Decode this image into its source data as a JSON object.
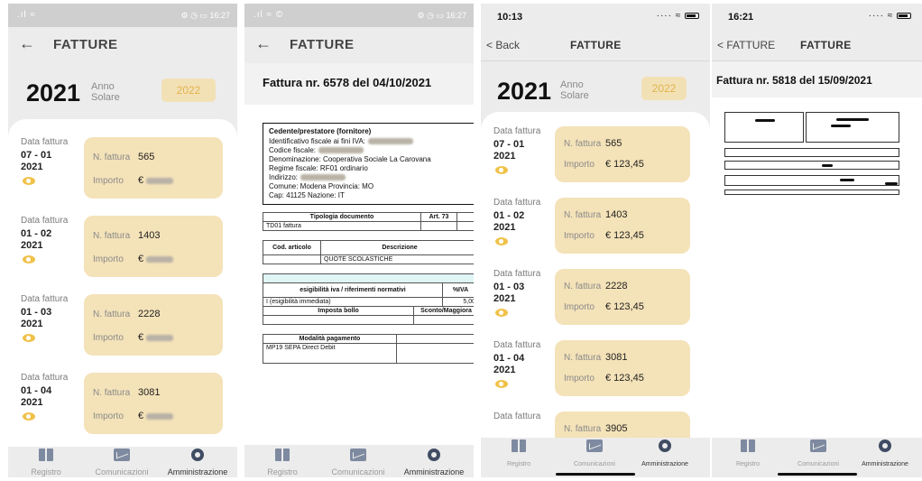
{
  "screens": [
    {
      "status": {
        "left": ".ıl ≈",
        "right": "⚙ ◷ ▭ 16:27"
      },
      "header": {
        "back": "←",
        "title": "FATTURE"
      },
      "year": {
        "value": "2021",
        "label1": "Anno",
        "label2": "Solare",
        "alt": "2022"
      },
      "invoices": [
        {
          "date_label": "Data fattura",
          "date": "07 - 01",
          "year": "2021",
          "num_label": "N. fattura",
          "num": "565",
          "amt_label": "Importo",
          "amt": "€"
        },
        {
          "date_label": "Data fattura",
          "date": "01 - 02",
          "year": "2021",
          "num_label": "N. fattura",
          "num": "1403",
          "amt_label": "Importo",
          "amt": "€"
        },
        {
          "date_label": "Data fattura",
          "date": "01 - 03",
          "year": "2021",
          "num_label": "N. fattura",
          "num": "2228",
          "amt_label": "Importo",
          "amt": "€"
        },
        {
          "date_label": "Data fattura",
          "date": "01 - 04",
          "year": "2021",
          "num_label": "N. fattura",
          "num": "3081",
          "amt_label": "Importo",
          "amt": "€"
        }
      ]
    },
    {
      "status": {
        "left": ".ıl ≈ ©",
        "right": "⚙ ◷ ▭ 16:27"
      },
      "header": {
        "back": "←",
        "title": "FATTURE"
      },
      "doc_title": "Fattura nr. 6578 del 04/10/2021",
      "cedente": {
        "heading": "Cedente/prestatore (fornitore)",
        "lines": [
          "Identificativo fiscale ai fini IVA:",
          "Codice fiscale:",
          "Denominazione: Cooperativa Sociale La Carovana",
          "Regime fiscale: RF01 ordinario",
          "Indirizzo:",
          "Comune: Modena Provincia: MO",
          "Cap: 41125 Nazione: IT"
        ]
      },
      "t1": {
        "h1": "Tipologia documento",
        "h2": "Art. 73",
        "v1": "TD01 fattura"
      },
      "t2": {
        "h1": "Cod. articolo",
        "h2": "Descrizione",
        "v2": "QUOTE SCOLASTICHE"
      },
      "t3": {
        "h1": "esigibilità iva / riferimenti normativi",
        "h2": "%IVA",
        "v1": "I (esigibilità immediata)",
        "v2": "5,00",
        "h3": "Imposta bollo",
        "h4": "Sconto/Maggiora"
      },
      "t4": {
        "h1": "Modalità pagamento",
        "v1": "MP19 SEPA Direct Debit"
      }
    },
    {
      "status": {
        "time": "10:13",
        "right": "····  ≈"
      },
      "header": {
        "back": "< Back",
        "title": "FATTURE"
      },
      "year": {
        "value": "2021",
        "label1": "Anno",
        "label2": "Solare",
        "alt": "2022"
      },
      "invoices": [
        {
          "date_label": "Data fattura",
          "date": "07 - 01",
          "year": "2021",
          "num_label": "N. fattura",
          "num": "565",
          "amt_label": "Importo",
          "amt": "€ 123,45"
        },
        {
          "date_label": "Data fattura",
          "date": "01 - 02",
          "year": "2021",
          "num_label": "N. fattura",
          "num": "1403",
          "amt_label": "Importo",
          "amt": "€ 123,45"
        },
        {
          "date_label": "Data fattura",
          "date": "01 - 03",
          "year": "2021",
          "num_label": "N. fattura",
          "num": "2228",
          "amt_label": "Importo",
          "amt": "€ 123,45"
        },
        {
          "date_label": "Data fattura",
          "date": "01 - 04",
          "year": "2021",
          "num_label": "N. fattura",
          "num": "3081",
          "amt_label": "Importo",
          "amt": "€ 123,45"
        },
        {
          "date_label": "Data fattura",
          "date": "",
          "year": "",
          "num_label": "N. fattura",
          "num": "3905",
          "amt_label": "",
          "amt": ""
        }
      ]
    },
    {
      "status": {
        "time": "16:21",
        "right": "····  ≈"
      },
      "header": {
        "back": "< FATTURE",
        "title": "FATTURE"
      },
      "doc_title": "Fattura nr. 5818 del 15/09/2021"
    }
  ],
  "tabs": [
    {
      "label": "Registro",
      "icon": "book-icon"
    },
    {
      "label": "Comunicazioni",
      "icon": "mail-icon"
    },
    {
      "label": "Amministrazione",
      "icon": "gear-icon"
    }
  ]
}
